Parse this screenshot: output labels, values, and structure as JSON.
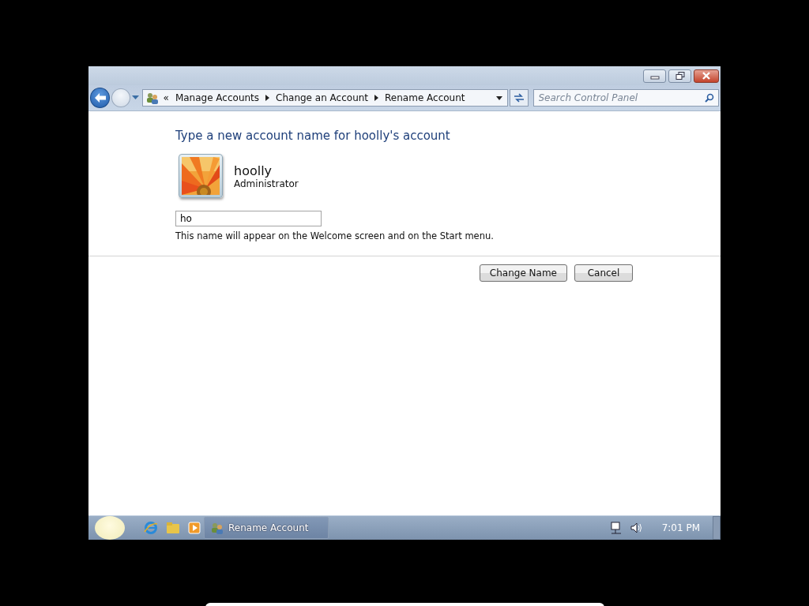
{
  "address_bar": {
    "overflow": "«",
    "breadcrumbs": [
      "Manage Accounts",
      "Change an Account",
      "Rename Account"
    ]
  },
  "search": {
    "placeholder": "Search Control Panel"
  },
  "heading": "Type a new account name for hoolly's account",
  "account": {
    "name": "hoolly",
    "role": "Administrator"
  },
  "name_field": {
    "value": "ho"
  },
  "hint": "This name will appear on the Welcome screen and on the Start menu.",
  "buttons": [
    "Change Name",
    "Cancel"
  ],
  "taskbar": {
    "tasks": [
      {
        "label": "Rename Account",
        "selected": true
      }
    ],
    "clock": "7:01 PM"
  }
}
